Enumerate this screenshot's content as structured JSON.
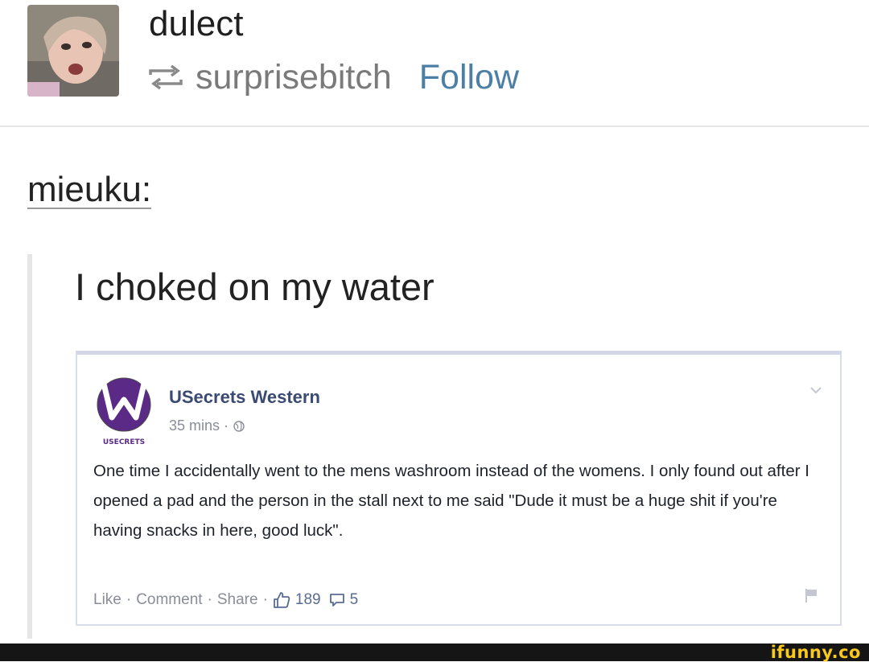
{
  "post": {
    "username": "dulect",
    "reblogged_from": "surprisebitch",
    "follow_label": "Follow",
    "source_user": "mieuku:",
    "quote": "I choked on my water"
  },
  "facebook_post": {
    "page_name": "USecrets Western",
    "logo_text": "USECRETS",
    "time": "35 mins",
    "body": "One time I accidentally went to the mens washroom instead of the womens. I only found out after I opened a pad and the person in the stall next to me said \"Dude it must be a huge shit if you're having snacks in here, good luck\".",
    "actions": {
      "like": "Like",
      "comment": "Comment",
      "share": "Share"
    },
    "like_count": "189",
    "comment_count": "5"
  },
  "watermark": "ifunny.co",
  "icons": [
    "avatar-photo",
    "reblog-icon",
    "usecrets-logo",
    "globe-icon",
    "chevron-down-icon",
    "like-icon",
    "comment-icon",
    "flag-icon"
  ],
  "colors": {
    "follow": "#4b7fa6",
    "fb_name": "#3b4a72",
    "logo_purple": "#5b2a86",
    "watermark": "#f7c81d"
  }
}
